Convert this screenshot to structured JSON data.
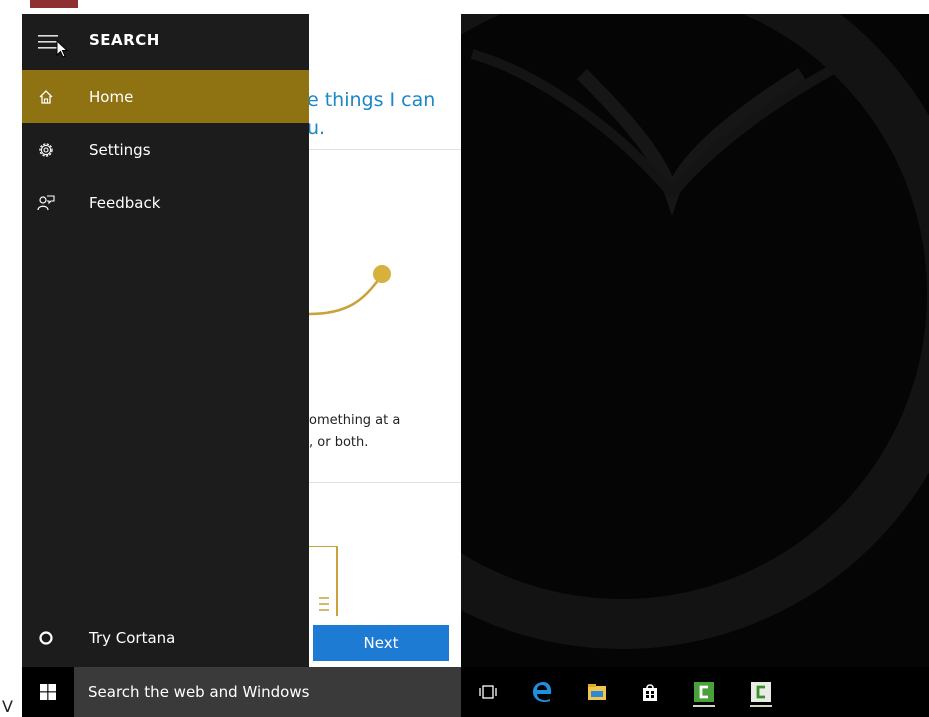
{
  "menu": {
    "title": "SEARCH",
    "items": [
      {
        "label": "Home",
        "icon": "home-icon",
        "active": true
      },
      {
        "label": "Settings",
        "icon": "gear-icon",
        "active": false
      },
      {
        "label": "Feedback",
        "icon": "feedback-icon",
        "active": false
      }
    ],
    "try_cortana": "Try Cortana"
  },
  "cortana_panel": {
    "headline_line1": "e things I can",
    "headline_line2": "u.",
    "body_line1": "omething at a",
    "body_line2": ", or both.",
    "next_label": "Next"
  },
  "taskbar": {
    "search_placeholder": "Search the web and Windows",
    "icons": [
      "task-view-icon",
      "edge-icon",
      "file-explorer-icon",
      "store-icon",
      "camtasia-icon",
      "camtasia-recorder-icon"
    ]
  },
  "corner_text": "V",
  "colors": {
    "accent": "#8f7313",
    "menu_bg": "#1c1c1c",
    "search_box_bg": "#3a3a3a",
    "next_button": "#1e7bd3",
    "headline": "#1b86c8",
    "edge": "#1e90e0"
  }
}
